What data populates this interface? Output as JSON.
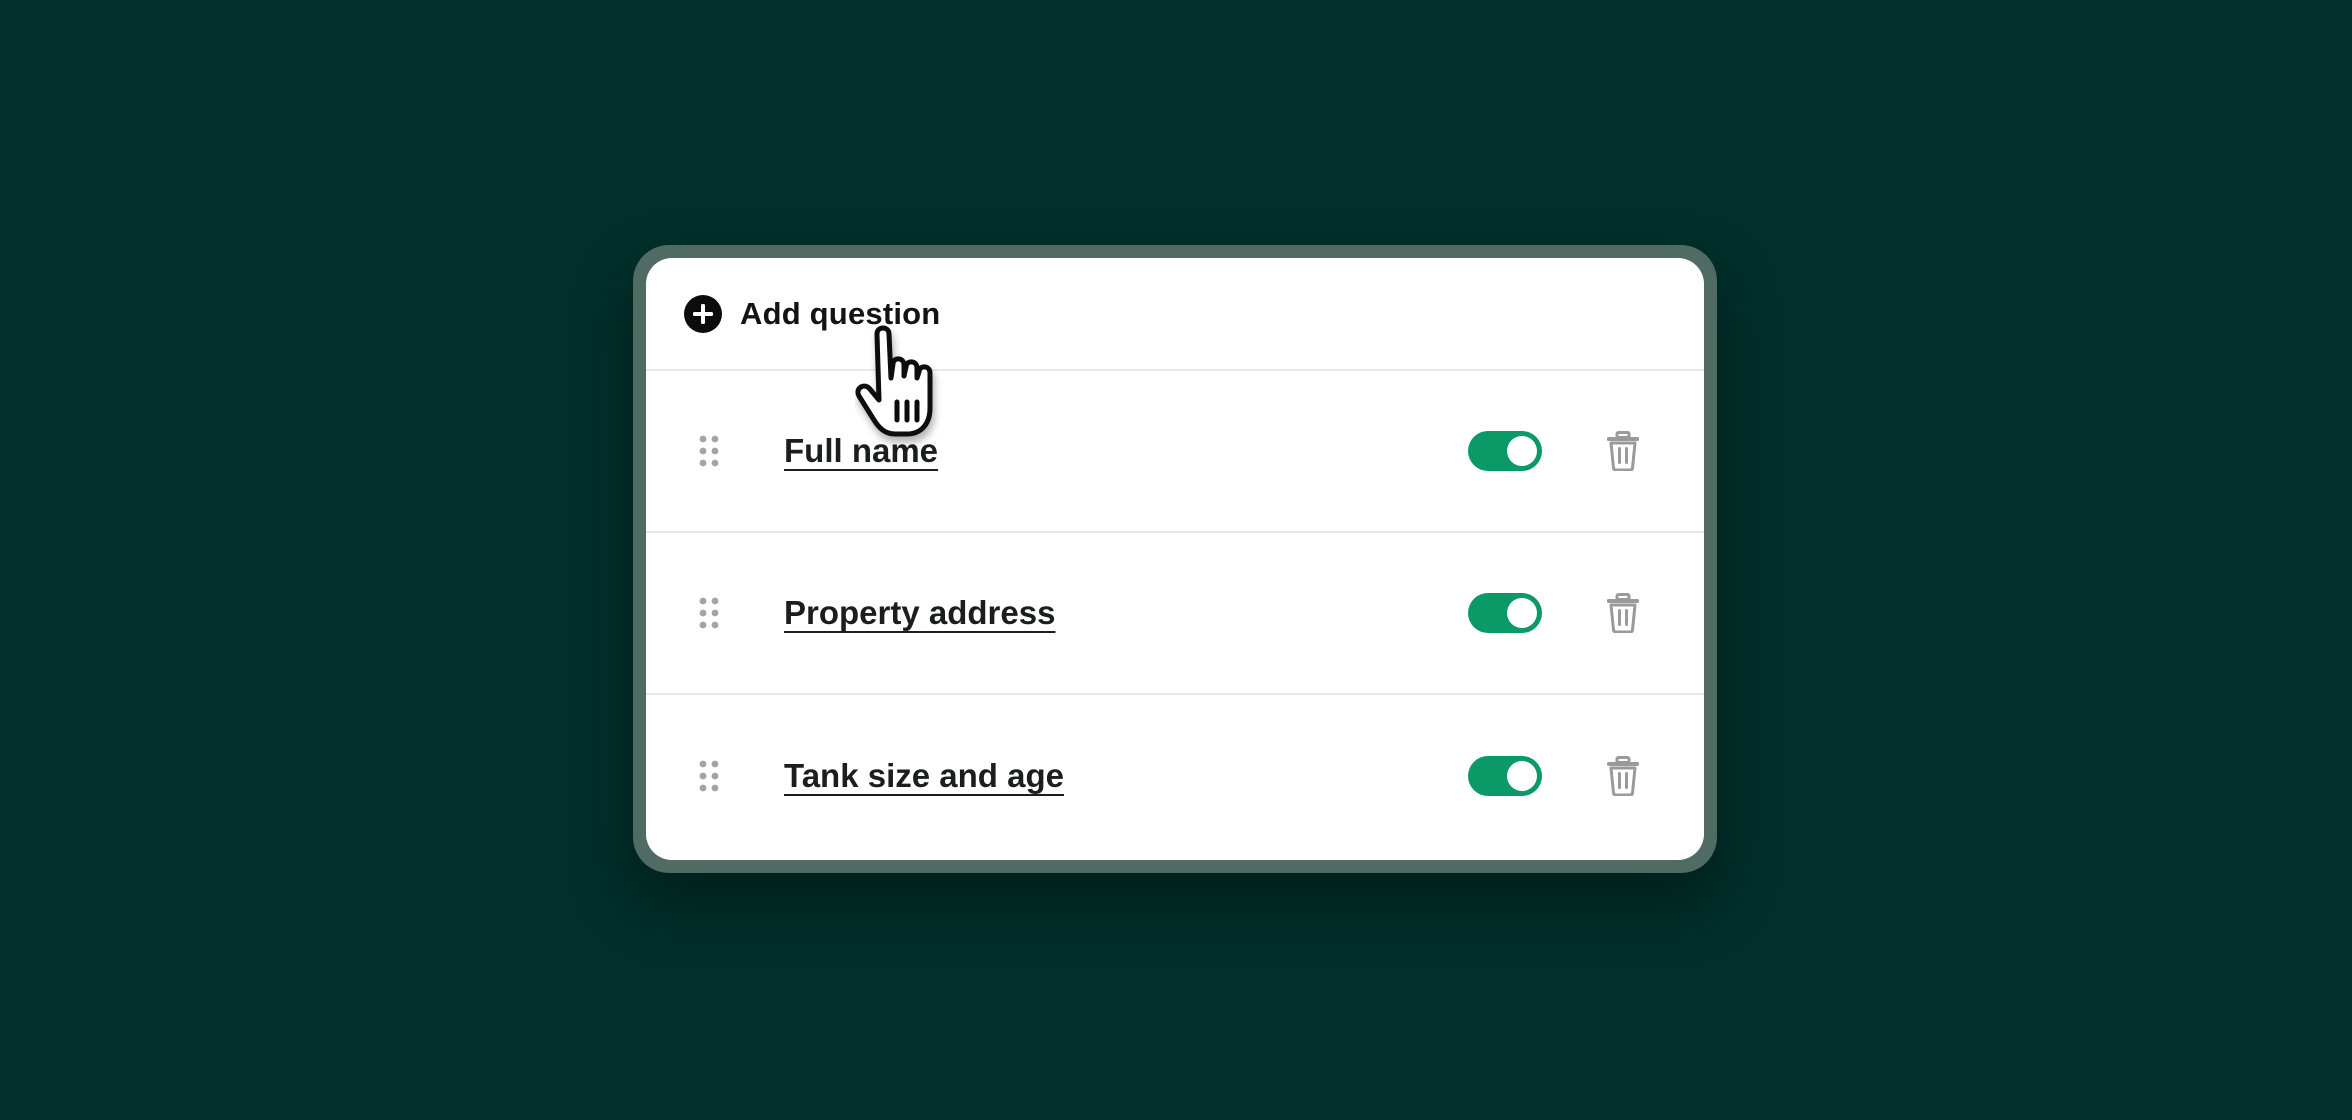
{
  "colors": {
    "background": "#022f2a",
    "frame": "#4f6b63",
    "card": "#ffffff",
    "toggle_on": "#0b9968",
    "icon_gray": "#9a9a9a"
  },
  "add_question": {
    "label": "Add question",
    "icon": "plus-circle-icon"
  },
  "questions": [
    {
      "label": "Full name",
      "enabled": true
    },
    {
      "label": "Property address",
      "enabled": true
    },
    {
      "label": "Tank size and age",
      "enabled": true
    }
  ],
  "icons": {
    "drag": "drag-handle-icon",
    "delete": "trash-icon",
    "cursor": "pointer-hand-icon"
  }
}
